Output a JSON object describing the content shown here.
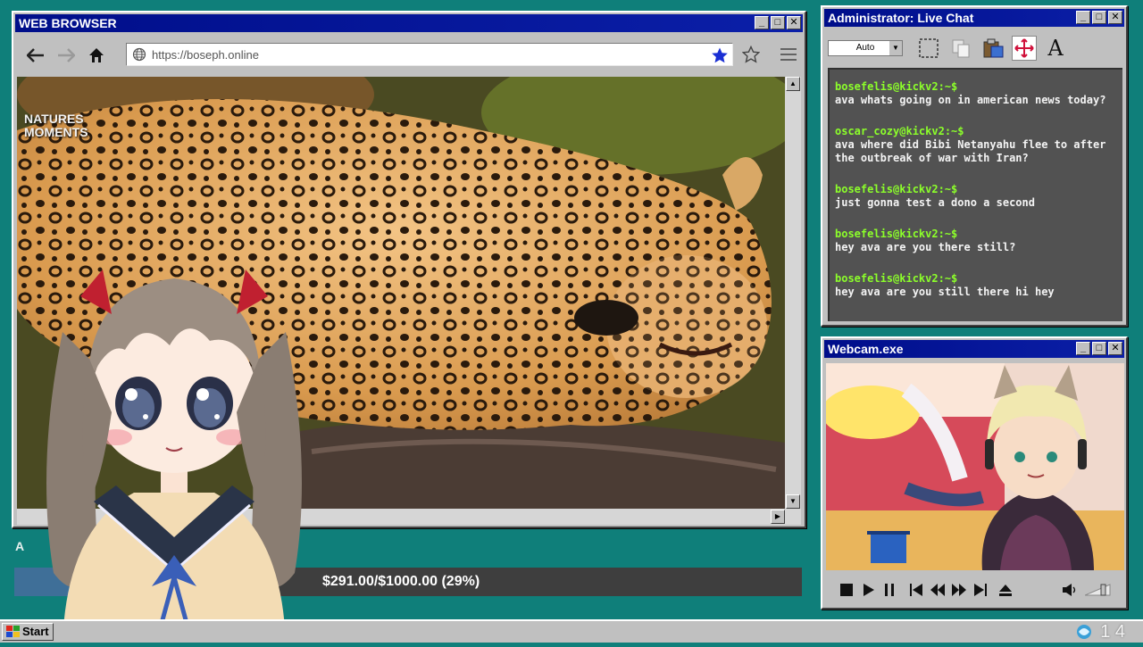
{
  "browser": {
    "title": "WEB BROWSER",
    "url": "https://boseph.online",
    "watermark_line1": "NATURES",
    "watermark_line2": "MOMENTS",
    "icons": {
      "back": "back-arrow-icon",
      "forward": "forward-arrow-icon",
      "home": "home-icon",
      "globe": "globe-icon",
      "bookmarked": "star-filled-icon",
      "bookmark": "star-outline-icon",
      "menu": "hamburger-menu-icon"
    }
  },
  "chat": {
    "title": "Administrator: Live Chat",
    "font_size_select": "Auto",
    "messages": [
      {
        "user": "bosefelis@kickv2:~$",
        "text": "ava whats going on in american news today?"
      },
      {
        "user": "oscar_cozy@kickv2:~$",
        "text": "ava where did Bibi Netanyahu flee to after the outbreak of war with Iran?"
      },
      {
        "user": "bosefelis@kickv2:~$",
        "text": "just gonna test a dono a second"
      },
      {
        "user": "bosefelis@kickv2:~$",
        "text": "hey ava are you there still?"
      },
      {
        "user": "bosefelis@kickv2:~$",
        "text": "hey ava are you still there hi hey"
      }
    ],
    "user_color": "#8cff2a"
  },
  "webcam": {
    "title": "Webcam.exe"
  },
  "donation": {
    "label": "$291.00/$1000.00 (29%)",
    "progress": 0.29,
    "partial_caption": "A"
  },
  "taskbar": {
    "start_label": "Start",
    "clock": "1 4"
  },
  "colors": {
    "desktop": "#0f7f7a",
    "titlebar": "#000e8a",
    "window": "#c0c0c0",
    "chat_bg": "#525252",
    "progress_fill": "#3f6f98"
  }
}
